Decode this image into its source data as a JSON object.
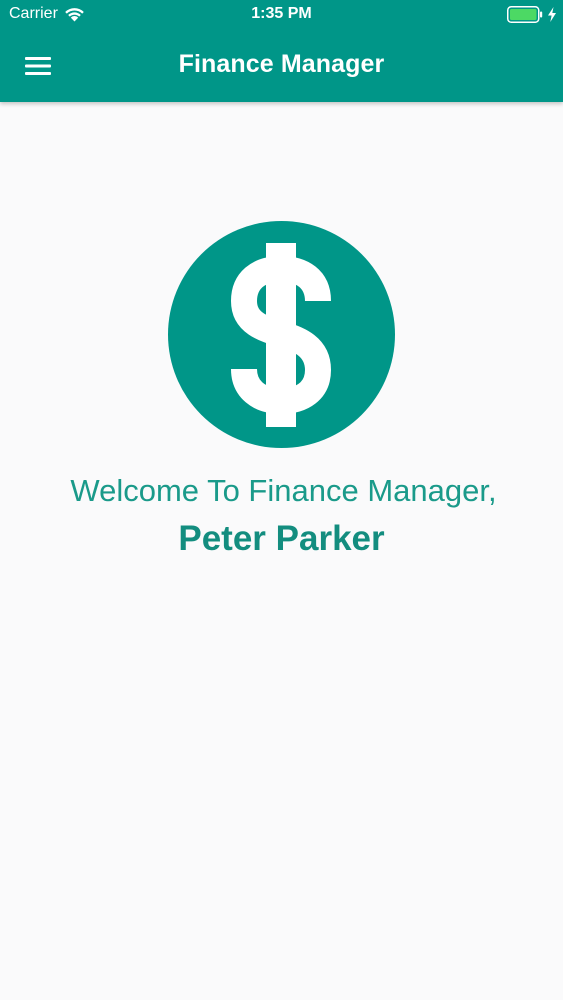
{
  "status_bar": {
    "carrier": "Carrier",
    "time": "1:35 PM",
    "battery_icon": "battery-charging-icon",
    "signal_icon": "wifi-icon"
  },
  "app_bar": {
    "title": "Finance Manager",
    "menu_icon": "hamburger-menu-icon"
  },
  "main": {
    "logo_icon": "dollar-sign-icon",
    "welcome_text": "Welcome To Finance Manager,",
    "user_name": "Peter Parker"
  },
  "colors": {
    "primary": "#009688",
    "text_accent": "#1a9a8a",
    "background": "#fafafb",
    "battery_fill": "#4cd964"
  }
}
